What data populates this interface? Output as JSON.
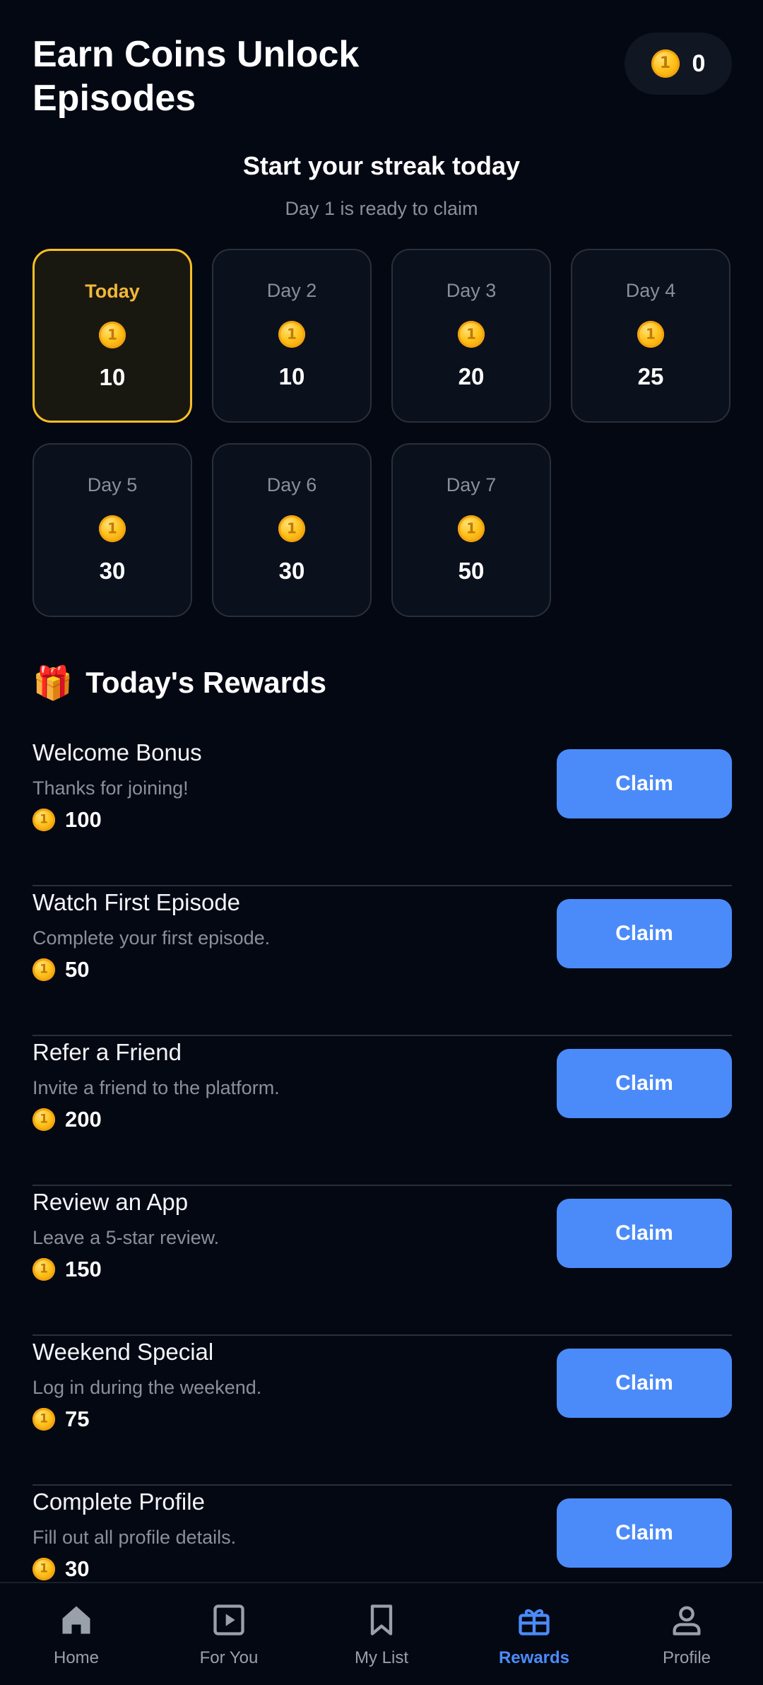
{
  "header": {
    "title": "Earn Coins Unlock Episodes",
    "balance": "0"
  },
  "streak": {
    "title": "Start your streak today",
    "subtitle": "Day 1 is ready to claim",
    "days": [
      {
        "label": "Today",
        "value": "10",
        "active": true
      },
      {
        "label": "Day 2",
        "value": "10"
      },
      {
        "label": "Day 3",
        "value": "20"
      },
      {
        "label": "Day 4",
        "value": "25"
      },
      {
        "label": "Day 5",
        "value": "30"
      },
      {
        "label": "Day 6",
        "value": "30"
      },
      {
        "label": "Day 7",
        "value": "50"
      }
    ]
  },
  "rewards": {
    "title": "Today's Rewards",
    "claim_label": "Claim",
    "items": [
      {
        "title": "Welcome Bonus",
        "desc": "Thanks for joining!",
        "amount": "100"
      },
      {
        "title": "Watch First Episode",
        "desc": "Complete your first episode.",
        "amount": "50"
      },
      {
        "title": "Refer a Friend",
        "desc": "Invite a friend to the platform.",
        "amount": "200"
      },
      {
        "title": "Review an App",
        "desc": "Leave a 5-star review.",
        "amount": "150"
      },
      {
        "title": "Weekend Special",
        "desc": "Log in during the weekend.",
        "amount": "75"
      },
      {
        "title": "Complete Profile",
        "desc": "Fill out all profile details.",
        "amount": "30"
      }
    ]
  },
  "nav": {
    "items": [
      {
        "label": "Home",
        "icon": "home-icon"
      },
      {
        "label": "For You",
        "icon": "play-square-icon"
      },
      {
        "label": "My List",
        "icon": "bookmark-icon"
      },
      {
        "label": "Rewards",
        "icon": "gift-icon",
        "active": true
      },
      {
        "label": "Profile",
        "icon": "user-icon"
      }
    ]
  },
  "colors": {
    "background": "#040813",
    "accent": "#4b8bf9",
    "highlight": "#fbbf24"
  }
}
